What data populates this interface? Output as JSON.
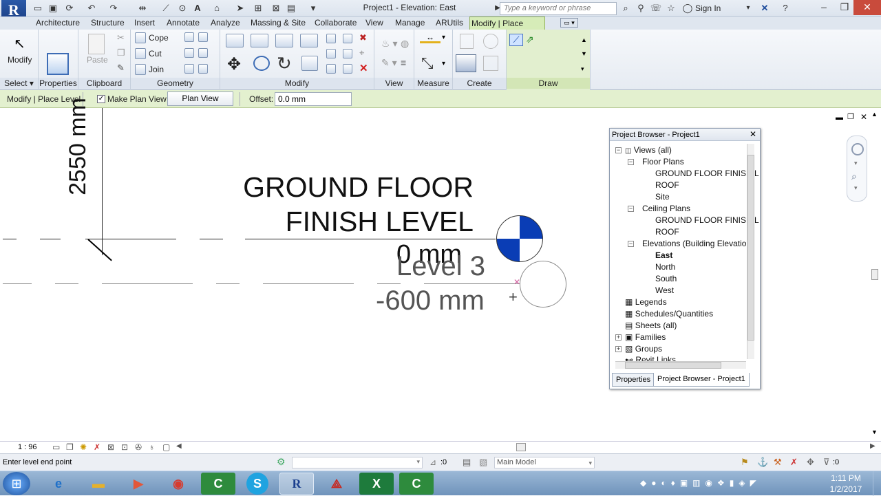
{
  "app": {
    "title": "Project1 - Elevation: East",
    "logo": "R",
    "search_placeholder": "Type a keyword or phrase",
    "sign_in": "Sign In"
  },
  "tabs": [
    "Architecture",
    "Structure",
    "Insert",
    "Annotate",
    "Analyze",
    "Massing & Site",
    "Collaborate",
    "View",
    "Manage",
    "ARUtils",
    "Modify | Place Level"
  ],
  "ribbon": {
    "modify_label": "Modify",
    "properties_label": "Properties",
    "paste_label": "Paste",
    "cope_label": "Cope",
    "cut_label": "Cut",
    "join_label": "Join",
    "panels": {
      "select": "Select",
      "properties": "Properties",
      "clipboard": "Clipboard",
      "geometry": "Geometry",
      "modify": "Modify",
      "view": "View",
      "measure": "Measure",
      "create": "Create",
      "draw": "Draw"
    }
  },
  "options_bar": {
    "context": "Modify | Place Level",
    "make_plan_view": "Make Plan View",
    "plan_view_types": "Plan View Types...",
    "offset_label": "Offset:",
    "offset_value": "0.0 mm"
  },
  "canvas": {
    "dim_text": "2550 mm",
    "level1_name_line1": "GROUND FLOOR",
    "level1_name_line2": "FINISH LEVEL",
    "level1_elev": "0 mm",
    "level2_name": "Level 3",
    "level2_elev": "-600 mm",
    "accent_blue": "#0a3db5"
  },
  "project_browser": {
    "title": "Project Browser - Project1",
    "views_all": "Views (all)",
    "floor_plans": "Floor Plans",
    "fp_items": [
      "GROUND FLOOR FINISH L",
      "ROOF",
      "Site"
    ],
    "ceiling_plans": "Ceiling Plans",
    "cp_items": [
      "GROUND FLOOR FINISH L",
      "ROOF"
    ],
    "elevations": "Elevations (Building Elevation",
    "el_items": [
      "East",
      "North",
      "South",
      "West"
    ],
    "legends": "Legends",
    "schedules": "Schedules/Quantities",
    "sheets": "Sheets (all)",
    "families": "Families",
    "groups": "Groups",
    "revit_links": "Revit Links",
    "tab_properties": "Properties",
    "tab_browser": "Project Browser - Project1"
  },
  "view_control": {
    "scale": "1 : 96"
  },
  "status": {
    "message": "Enter level end point",
    "selection_count": ":0",
    "model": "Main Model",
    "filter_count": ":0"
  },
  "taskbar": {
    "time": "1:11 PM",
    "date": "1/2/2017"
  }
}
